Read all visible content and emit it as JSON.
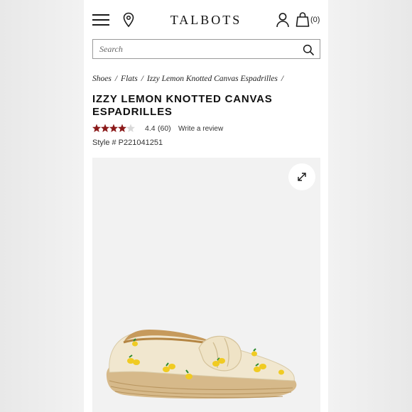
{
  "header": {
    "menu_icon": "hamburger-menu-icon",
    "location_icon": "map-pin-icon",
    "logo": "TALBOTS",
    "account_icon": "user-icon",
    "bag_icon": "shopping-bag-icon",
    "bag_count": "(0)"
  },
  "search": {
    "placeholder": "Search",
    "icon": "search-icon"
  },
  "breadcrumb": {
    "items": [
      "Shoes",
      "Flats",
      "Izzy Lemon Knotted Canvas Espadrilles"
    ],
    "separator": "/"
  },
  "product": {
    "title": "IZZY LEMON KNOTTED CANVAS ESPADRILLES",
    "rating_value": "4.4",
    "rating_stars": 4.4,
    "rating_count": "(60)",
    "write_review": "Write a review",
    "style_number": "Style # P221041251",
    "star_color": "#8b1a1a"
  },
  "image": {
    "expand_icon": "expand-arrows-icon",
    "alt": "Izzy Lemon Knotted Canvas Espadrilles"
  }
}
